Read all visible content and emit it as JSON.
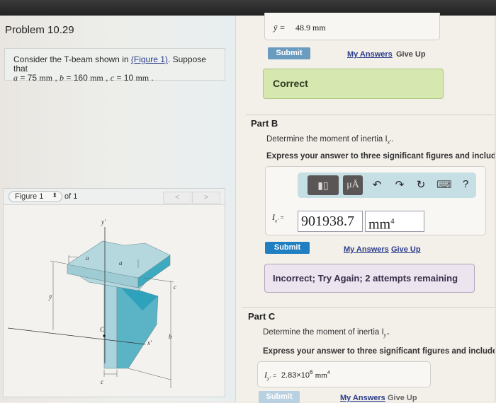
{
  "problem": {
    "title": "Problem 10.29",
    "statement_prefix": "Consider the T-beam shown in",
    "figure_link": "(Figure 1)",
    "statement_suffix": ". Suppose that",
    "params": [
      {
        "name": "a",
        "value": "75",
        "unit": "mm"
      },
      {
        "name": "b",
        "value": "160",
        "unit": "mm"
      },
      {
        "name": "c",
        "value": "10",
        "unit": "mm"
      }
    ],
    "param_text": {
      "a": "a",
      "a_eq": " = 75 ",
      "b": "b",
      "b_eq": " = 160 ",
      "c": "c",
      "c_eq": " = 10 ",
      "unit": "mm",
      "sep": " , ",
      "end": " ."
    }
  },
  "figure": {
    "selector_label": "Figure 1",
    "of_label": "of 1",
    "prev_label": "<",
    "next_label": ">",
    "labels": {
      "y_axis": "y′",
      "x_axis": "x′",
      "a1": "a",
      "a2": "a",
      "ybar": "ȳ",
      "c_top": "c",
      "c_centroid": "C",
      "b": "b",
      "c_bottom": "c"
    }
  },
  "part_a": {
    "answer_label": "ȳ =",
    "answer_value": "48.9 mm",
    "submit_label": "Submit",
    "my_answers_label": "My Answers",
    "give_up_label": "Give Up",
    "feedback": "Correct",
    "colors": {
      "submit": "#6a9cc0",
      "feedback_bg": "#d6e8b0"
    }
  },
  "part_b": {
    "title": "Part B",
    "prompt": "Determine the moment of inertia I",
    "prompt_sub": "x′",
    "instruction": "Express your answer to three significant figures and include",
    "toolbar": [
      {
        "icon": "template-icon",
        "glyph": "▮▯"
      },
      {
        "icon": "units-icon",
        "glyph": "μÅ"
      },
      {
        "icon": "undo-icon",
        "glyph": "↶"
      },
      {
        "icon": "redo-icon",
        "glyph": "↷"
      },
      {
        "icon": "reset-icon",
        "glyph": "↻"
      },
      {
        "icon": "keyboard-icon",
        "glyph": "⌨"
      },
      {
        "icon": "help-icon",
        "glyph": "?"
      }
    ],
    "answer_label": "I",
    "answer_sub": "x′",
    "answer_eq": "=",
    "answer_value": "901938.7",
    "answer_unit": "mm",
    "answer_unit_exp": "4",
    "submit_label": "Submit",
    "my_answers_label": "My Answers",
    "give_up_label": "Give Up",
    "feedback": "Incorrect; Try Again; 2 attempts remaining",
    "colors": {
      "submit": "#1f7fc1",
      "feedback_bg": "#ece4ef"
    }
  },
  "part_c": {
    "title": "Part C",
    "prompt": "Determine the moment of inertia I",
    "prompt_sub": "y′",
    "instruction": "Express your answer to three significant figures and include",
    "answer_label": "I",
    "answer_sub": "y′",
    "answer_eq": "=",
    "answer_mantissa": "2.83×10",
    "answer_exp": "6",
    "answer_unit": "mm",
    "answer_unit_exp": "4",
    "submit_label": "Submit",
    "my_answers_label": "My Answers",
    "give_up_label": "Give Up",
    "colors": {
      "submit": "#b8d0e0"
    }
  }
}
